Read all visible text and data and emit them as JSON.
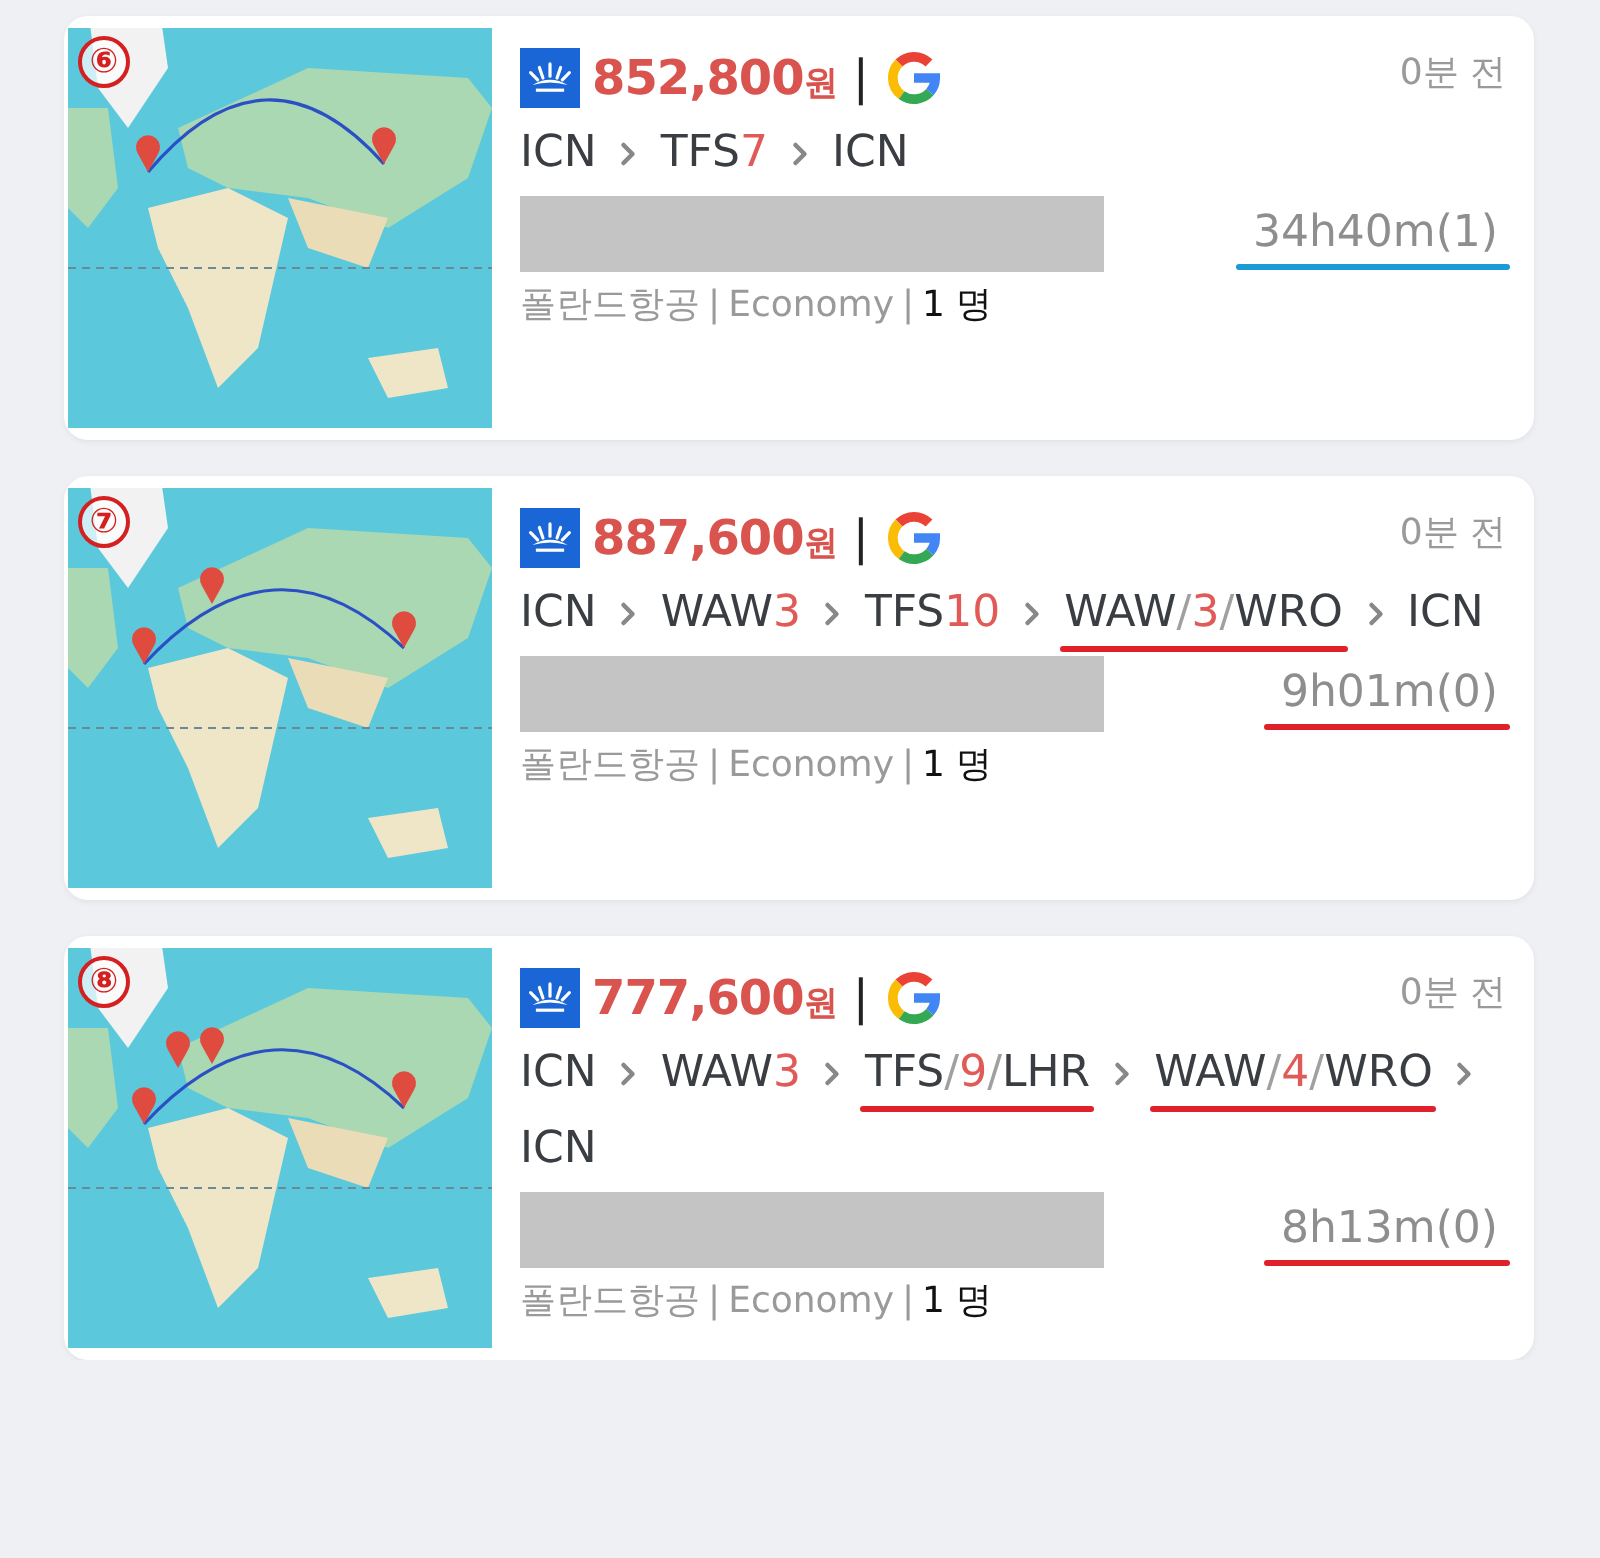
{
  "results": [
    {
      "index": "⑥",
      "price": "852,800",
      "currency": "원",
      "divider": "|",
      "posted": "0분 전",
      "route": [
        {
          "parts": [
            {
              "text": "ICN",
              "kind": "code"
            }
          ]
        },
        {
          "parts": [
            {
              "text": "TFS",
              "kind": "code"
            },
            {
              "text": "7",
              "kind": "count"
            }
          ]
        },
        {
          "parts": [
            {
              "text": "ICN",
              "kind": "code"
            }
          ]
        }
      ],
      "duration": {
        "text": "34h40m(1)",
        "color": "#1b9ad8"
      },
      "airline": "폴란드항공",
      "separator_1": "|",
      "cabin": "Economy",
      "separator_2": "|",
      "passengers": "1 명"
    },
    {
      "index": "⑦",
      "price": "887,600",
      "currency": "원",
      "divider": "|",
      "posted": "0분 전",
      "route": [
        {
          "parts": [
            {
              "text": "ICN",
              "kind": "code"
            }
          ]
        },
        {
          "parts": [
            {
              "text": "WAW",
              "kind": "code"
            },
            {
              "text": "3",
              "kind": "count"
            }
          ]
        },
        {
          "parts": [
            {
              "text": "TFS",
              "kind": "code"
            },
            {
              "text": "10",
              "kind": "count"
            }
          ]
        },
        {
          "color": "#e0202a",
          "parts": [
            {
              "text": "WAW",
              "kind": "code"
            },
            {
              "text": "/",
              "kind": "sep"
            },
            {
              "text": "3",
              "kind": "count"
            },
            {
              "text": "/",
              "kind": "sep"
            },
            {
              "text": "WRO",
              "kind": "code"
            }
          ]
        },
        {
          "parts": [
            {
              "text": "ICN",
              "kind": "code"
            }
          ]
        }
      ],
      "duration": {
        "text": "9h01m(0)",
        "color": "#e0202a"
      },
      "airline": "폴란드항공",
      "separator_1": "|",
      "cabin": "Economy",
      "separator_2": "|",
      "passengers": "1 명"
    },
    {
      "index": "⑧",
      "price": "777,600",
      "currency": "원",
      "divider": "|",
      "posted": "0분 전",
      "route": [
        {
          "parts": [
            {
              "text": "ICN",
              "kind": "code"
            }
          ]
        },
        {
          "parts": [
            {
              "text": "WAW",
              "kind": "code"
            },
            {
              "text": "3",
              "kind": "count"
            }
          ]
        },
        {
          "color": "#e0202a",
          "parts": [
            {
              "text": "TFS",
              "kind": "code"
            },
            {
              "text": "/",
              "kind": "sep"
            },
            {
              "text": "9",
              "kind": "count"
            },
            {
              "text": "/",
              "kind": "sep"
            },
            {
              "text": "LHR",
              "kind": "code"
            }
          ]
        },
        {
          "color": "#e0202a",
          "parts": [
            {
              "text": "WAW",
              "kind": "code"
            },
            {
              "text": "/",
              "kind": "sep"
            },
            {
              "text": "4",
              "kind": "count"
            },
            {
              "text": "/",
              "kind": "sep"
            },
            {
              "text": "WRO",
              "kind": "code"
            }
          ]
        },
        {
          "parts": [
            {
              "text": "ICN",
              "kind": "code"
            }
          ]
        }
      ],
      "duration": {
        "text": "8h13m(0)",
        "color": "#e0202a"
      },
      "airline": "폴란드항공",
      "separator_1": "|",
      "cabin": "Economy",
      "separator_2": "|",
      "passengers": "1 명"
    }
  ]
}
